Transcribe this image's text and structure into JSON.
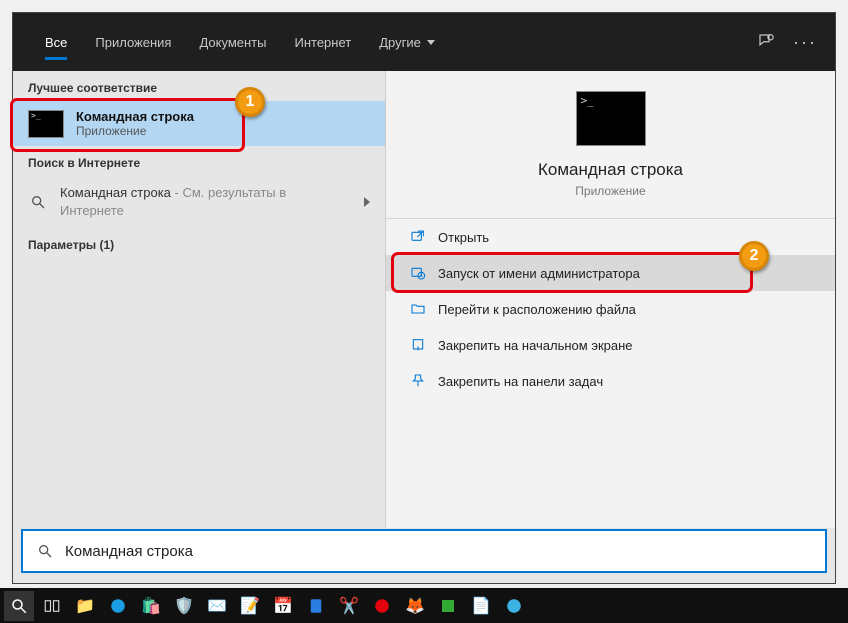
{
  "header": {
    "tabs": [
      "Все",
      "Приложения",
      "Документы",
      "Интернет",
      "Другие"
    ]
  },
  "left": {
    "best_match_header": "Лучшее соответствие",
    "best_match": {
      "title": "Командная строка",
      "subtitle": "Приложение"
    },
    "web_header": "Поиск в Интернете",
    "web_result": {
      "query": "Командная строка",
      "suffix": " - См. результаты в Интернете"
    },
    "params_header": "Параметры (1)"
  },
  "right": {
    "title": "Командная строка",
    "subtitle": "Приложение",
    "actions": [
      "Открыть",
      "Запуск от имени администратора",
      "Перейти к расположению файла",
      "Закрепить на начальном экране",
      "Закрепить на панели задач"
    ]
  },
  "search": {
    "value": "Командная строка"
  },
  "badges": {
    "one": "1",
    "two": "2"
  }
}
